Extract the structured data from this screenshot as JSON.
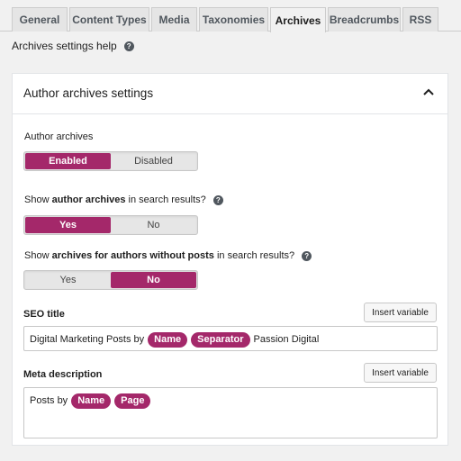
{
  "tabs": [
    "General",
    "Content Types",
    "Media",
    "Taxonomies",
    "Archives",
    "Breadcrumbs",
    "RSS"
  ],
  "active_tab": "Archives",
  "help": {
    "label": "Archives settings help",
    "icon": "question-circle-icon"
  },
  "panel": {
    "title": "Author archives settings",
    "collapse_icon": "chevron-up-icon",
    "author_archives": {
      "label": "Author archives",
      "options": [
        "Enabled",
        "Disabled"
      ],
      "selected": "Enabled"
    },
    "show_in_search": {
      "label_pre": "Show ",
      "label_bold": "author archives",
      "label_post": " in search results?",
      "options": [
        "Yes",
        "No"
      ],
      "selected": "Yes"
    },
    "show_without_posts": {
      "label_pre": "Show ",
      "label_bold": "archives for authors without posts",
      "label_post": " in search results?",
      "options": [
        "Yes",
        "No"
      ],
      "selected": "No"
    },
    "seo_title": {
      "label": "SEO title",
      "insert_label": "Insert variable",
      "text_before": "Digital Marketing Posts by",
      "variables": [
        "Name",
        "Separator"
      ],
      "text_after": "Passion Digital"
    },
    "meta_description": {
      "label": "Meta description",
      "insert_label": "Insert variable",
      "text_before": "Posts by",
      "variables": [
        "Name",
        "Page"
      ]
    }
  },
  "colors": {
    "accent": "#a4286a",
    "tab_bg": "#e5e5e5",
    "page_bg": "#f1f1f1"
  }
}
